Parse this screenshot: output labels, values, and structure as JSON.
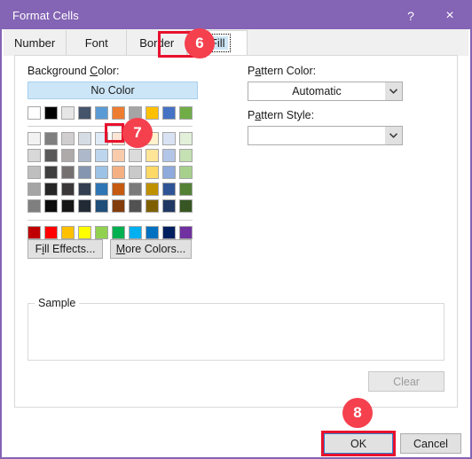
{
  "window": {
    "title": "Format Cells",
    "help_icon": "?",
    "close_icon": "×",
    "titlebar_color": "#8464b4"
  },
  "tabs": [
    {
      "label": "Number",
      "selected": false
    },
    {
      "label": "Font",
      "selected": false
    },
    {
      "label": "Border",
      "selected": false
    },
    {
      "label": "Fill",
      "selected": true
    }
  ],
  "fill_tab": {
    "background_color": {
      "label": "Background Color:",
      "no_color_label": "No Color",
      "theme_colors": [
        "#ffffff",
        "#000000",
        "#e7e6e6",
        "#44546a",
        "#5b9bd5",
        "#ed7d31",
        "#a5a5a5",
        "#ffc000",
        "#4472c4",
        "#70ad47"
      ],
      "tint_rows": [
        [
          "#f2f2f2",
          "#7f7f7f",
          "#d0cece",
          "#d6dce4",
          "#deebf6",
          "#fbe5d5",
          "#ededed",
          "#fff2cc",
          "#d9e2f3",
          "#e2efd9"
        ],
        [
          "#d8d8d8",
          "#595959",
          "#aeaaaa",
          "#adb9ca",
          "#bdd6ee",
          "#f7cbac",
          "#dbdbdb",
          "#ffe598",
          "#b4c6e7",
          "#c5e0b3"
        ],
        [
          "#bfbfbf",
          "#3f3f3f",
          "#757070",
          "#8496b0",
          "#9cc2e5",
          "#f4b083",
          "#c9c9c9",
          "#fed965",
          "#8faadc",
          "#a8d08d"
        ],
        [
          "#a5a5a5",
          "#262626",
          "#3a3838",
          "#333f50",
          "#2e75b5",
          "#c55a11",
          "#7b7b7b",
          "#bf9000",
          "#2f5496",
          "#538135"
        ],
        [
          "#7f7f7f",
          "#0c0c0c",
          "#171616",
          "#222a35",
          "#1f4e79",
          "#833c0b",
          "#525252",
          "#7f6000",
          "#1f3864",
          "#375623"
        ]
      ],
      "standard_colors": [
        "#c00000",
        "#ff0000",
        "#ffc000",
        "#ffff00",
        "#92d050",
        "#00b050",
        "#00b0f0",
        "#0070c0",
        "#002060",
        "#7030a0"
      ],
      "selected_swatch": {
        "row": 0,
        "col": 5,
        "color": "#fbe5d5"
      },
      "fill_effects_label": "Fill Effects...",
      "more_colors_label": "More Colors..."
    },
    "pattern_color": {
      "label": "Pattern Color:",
      "value": "Automatic",
      "arrow_icon": "chevron-down-icon"
    },
    "pattern_style": {
      "label": "Pattern Style:",
      "value": "",
      "arrow_icon": "chevron-down-icon"
    },
    "sample": {
      "legend": "Sample",
      "content": ""
    },
    "clear_button": {
      "label": "Clear",
      "enabled": false
    }
  },
  "footer": {
    "ok_label": "OK",
    "cancel_label": "Cancel"
  },
  "annotations": {
    "badge_color": "#f5404e",
    "highlight_color": "#e8112d",
    "steps": [
      {
        "number": "6",
        "target": "fill-tab"
      },
      {
        "number": "7",
        "target": "background-color-swatch"
      },
      {
        "number": "8",
        "target": "ok-button"
      }
    ]
  }
}
